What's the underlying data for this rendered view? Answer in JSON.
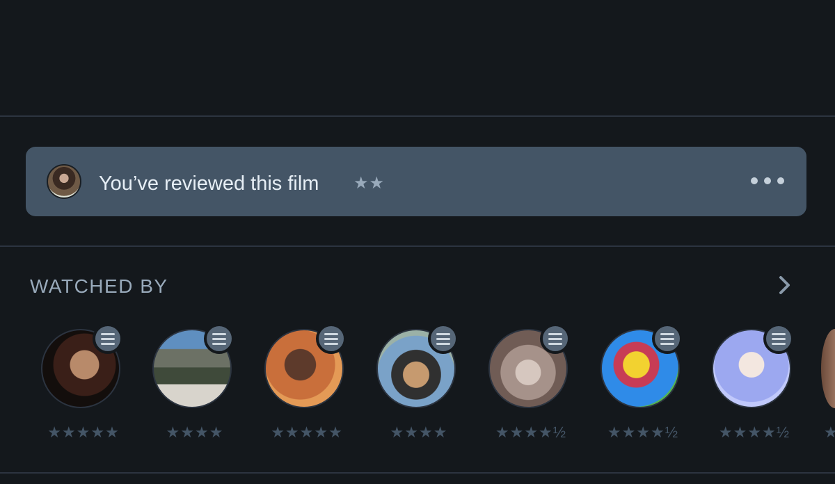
{
  "review": {
    "text": "You’ve reviewed this film",
    "stars": "★★"
  },
  "watched_by": {
    "label": "WATCHED BY",
    "people": [
      {
        "rating": "★★★★★",
        "color_a": "#3a1f18",
        "color_b": "#b88a6a"
      },
      {
        "rating": "★★★★",
        "color_a": "#2d3a48",
        "color_b": "#9aa7a8"
      },
      {
        "rating": "★★★★★",
        "color_a": "#c96f3b",
        "color_b": "#3c2a22"
      },
      {
        "rating": "★★★★",
        "color_a": "#6c8fb0",
        "color_b": "#c69a6f"
      },
      {
        "rating": "★★★★½",
        "color_a": "#b9a7a0",
        "color_b": "#705c55"
      },
      {
        "rating": "★★★★½",
        "color_a": "#2f8be8",
        "color_b": "#f2d230"
      },
      {
        "rating": "★★★★½",
        "color_a": "#9ca8f0",
        "color_b": "#ebe2f2"
      }
    ],
    "partial_rating": "★"
  },
  "colors": {
    "background": "#14181c",
    "review_bar": "#445566",
    "star_gray": "#445566"
  }
}
